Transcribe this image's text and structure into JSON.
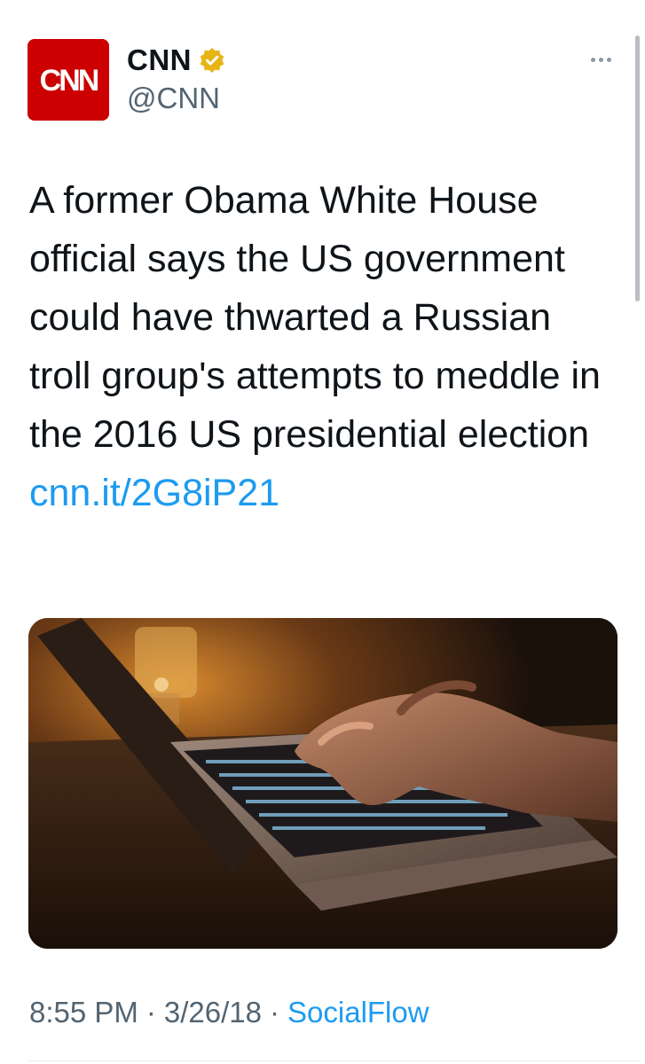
{
  "author": {
    "logo_text": "CNN",
    "display_name": "CNN",
    "handle": "@CNN",
    "verified_badge_color": "#e7b416",
    "avatar_color": "#cc0000"
  },
  "menu": {
    "icon": "more-horizontal-icon"
  },
  "tweet": {
    "text": "A former Obama White House official says the US government could have thwarted a Russian troll group's attempts to meddle in the 2016 US presidential election ",
    "link": "cnn.it/2G8iP21",
    "link_color": "#1d9bf0"
  },
  "media": {
    "description_icon": "photo-laptop-typing"
  },
  "meta": {
    "time": "8:55 PM",
    "date": "3/26/18",
    "separator": "·",
    "source": "SocialFlow"
  }
}
